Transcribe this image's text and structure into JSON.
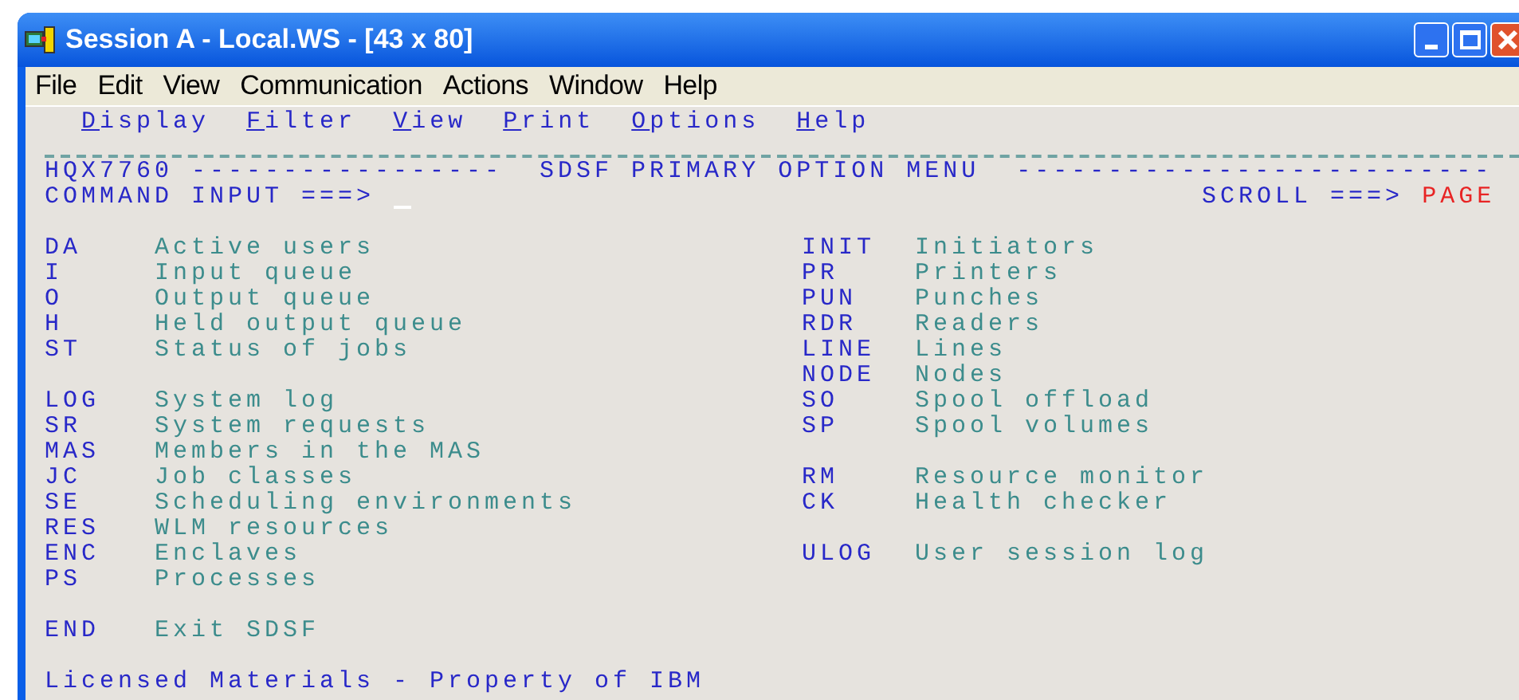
{
  "window": {
    "title": "Session A - Local.WS - [43 x 80]"
  },
  "menu_bar": [
    "File",
    "Edit",
    "View",
    "Communication",
    "Actions",
    "Window",
    "Help"
  ],
  "action_bar": [
    "Display",
    "Filter",
    "View",
    "Print",
    "Options",
    "Help"
  ],
  "header": {
    "panel_id": "HQX7760",
    "left_rule": "-----------------",
    "title": "SDSF PRIMARY OPTION MENU",
    "right_rule": "--------------------------"
  },
  "command": {
    "label": "COMMAND INPUT ===>"
  },
  "scroll": {
    "label": "SCROLL ===>",
    "value": "PAGE"
  },
  "options_left": [
    [
      {
        "code": "DA",
        "description": "Active users"
      },
      {
        "code": "I",
        "description": "Input queue"
      },
      {
        "code": "O",
        "description": "Output queue"
      },
      {
        "code": "H",
        "description": "Held output queue"
      },
      {
        "code": "ST",
        "description": "Status of jobs"
      }
    ],
    [
      {
        "code": "LOG",
        "description": "System log"
      },
      {
        "code": "SR",
        "description": "System requests"
      },
      {
        "code": "MAS",
        "description": "Members in the MAS"
      },
      {
        "code": "JC",
        "description": "Job classes"
      },
      {
        "code": "SE",
        "description": "Scheduling environments"
      },
      {
        "code": "RES",
        "description": "WLM resources"
      },
      {
        "code": "ENC",
        "description": "Enclaves"
      },
      {
        "code": "PS",
        "description": "Processes"
      }
    ],
    [
      {
        "code": "END",
        "description": "Exit SDSF"
      }
    ]
  ],
  "options_right": [
    [
      {
        "code": "INIT",
        "description": "Initiators"
      },
      {
        "code": "PR",
        "description": "Printers"
      },
      {
        "code": "PUN",
        "description": "Punches"
      },
      {
        "code": "RDR",
        "description": "Readers"
      },
      {
        "code": "LINE",
        "description": "Lines"
      },
      {
        "code": "NODE",
        "description": "Nodes"
      },
      {
        "code": "SO",
        "description": "Spool offload"
      },
      {
        "code": "SP",
        "description": "Spool volumes"
      }
    ],
    [
      {
        "code": "RM",
        "description": "Resource monitor"
      },
      {
        "code": "CK",
        "description": "Health checker"
      }
    ],
    [
      {
        "code": "ULOG",
        "description": "User session log"
      }
    ]
  ],
  "footer": "Licensed Materials - Property of IBM"
}
